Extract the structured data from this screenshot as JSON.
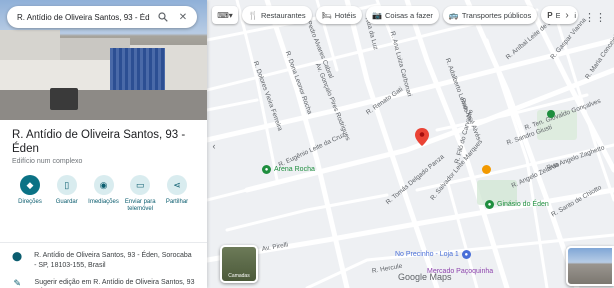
{
  "search": {
    "value": "R. Antídio de Oliveira Santos, 93 - Éd"
  },
  "place": {
    "title": "R. Antídio de Oliveira Santos, 93 - Éden",
    "subtitle": "Edifício num complexo"
  },
  "actions": [
    {
      "label": "Direções",
      "icon": "directions-icon"
    },
    {
      "label": "Guardar",
      "icon": "bookmark-icon"
    },
    {
      "label": "Imediações",
      "icon": "nearby-icon"
    },
    {
      "label": "Enviar para telemóvel",
      "icon": "phone-icon"
    },
    {
      "label": "Partilhar",
      "icon": "share-icon"
    }
  ],
  "info": {
    "address": "R. Antídio de Oliveira Santos, 93 - Éden, Sorocaba - SP, 18103-155, Brasil",
    "suggest": "Sugerir edição em R. Antídio de Oliveira Santos, 93 - Éden"
  },
  "chips": [
    {
      "label": "Restaurantes",
      "icon": "fork-knife-icon"
    },
    {
      "label": "Hotéis",
      "icon": "bed-icon"
    },
    {
      "label": "Coisas a fazer",
      "icon": "camera-icon"
    },
    {
      "label": "Transportes públicos",
      "icon": "bus-icon"
    },
    {
      "label": "Estaci",
      "icon": "parking-icon"
    }
  ],
  "layers_label": "Camadas",
  "map": {
    "streets": [
      "R. Dolores Vieira Ferreira",
      "R. Dona Leonor Rocha",
      "Av. Gonçalo Pires Rodrigues",
      "R. Pedro Alvares Cabral",
      "R. Ana Luiza Carbonari",
      "Rua da Luz",
      "R. Renato Gati",
      "R. Adalberto Lemos",
      "Rua José Alvés",
      "R. Aníbal Leite de Sousa",
      "R. Gaspar Vianna",
      "R. Maria Conceição",
      "R. Eugênio Leite da Cruz",
      "R. Tomás Delgado Panza",
      "R. Salvador Leite Marques",
      "R. Filó do Carvalho",
      "R. Angelo Zelardo",
      "R. Sandro Giusti",
      "Rua Angelo Zaghetto",
      "R. Ten. Giovaldo Gonçalves",
      "R. Santo de Chiotto",
      "Av. Pirelli",
      "R. Hercule"
    ],
    "pois": [
      {
        "name": "Arena Rocha",
        "color": "#1e8e3e"
      },
      {
        "name": "Ginásio do Éden",
        "color": "#1e8e3e"
      },
      {
        "name": "No Precinho - Loja 1",
        "color": "#4a6fd8"
      },
      {
        "name": "Mercado Paçoquinha",
        "color": "#8e44ad"
      }
    ],
    "marker_color": "#ea4335",
    "logo": "Google Maps"
  }
}
